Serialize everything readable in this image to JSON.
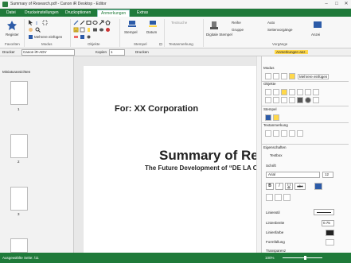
{
  "window": {
    "title": "Summary of Research.pdf - Canon iR Desktop - Editor",
    "minimize": "–",
    "maximize": "□",
    "close": "✕"
  },
  "menu": {
    "tabs": [
      "Datei",
      "Druckeinstellungen",
      "Druckoptionen",
      "Anmerkungen",
      "Extras"
    ],
    "active": "Anmerkungen"
  },
  "ribbon": {
    "groups": {
      "favoriten": "Favoriten",
      "modus": "Modus",
      "objekte": "Objekte",
      "stempel": "Stempel",
      "textanmerkung": "Textanmerkung",
      "vorgaenge": "Vorgänge"
    },
    "buttons": {
      "register": "Register",
      "mehrere_einfuegen": "Mehrere einfügen",
      "stempel": "Stempel",
      "datum": "Datum",
      "textsuche": "Textsuche",
      "digitale_stempel": "Digitale Stempel",
      "reihe": "Reihe",
      "auto": "Auto",
      "gruppe": "Gruppe",
      "seitenvorgaenge": "Seitenvorgänge",
      "anzeige": "Anzei"
    }
  },
  "printbar": {
    "drucker_label": "Drucker",
    "drucker_value": "Canon iR-ADV",
    "kopien_label": "Kopien",
    "kopien_value": "1",
    "drucken": "Drucken",
    "anmerkungen_anz": "Anmerkungen anz."
  },
  "left_panel": {
    "title": "Miniaturansichten",
    "pages": [
      "1",
      "2",
      "3"
    ]
  },
  "document": {
    "for_line": "For: XX Corporation",
    "heading": "Summary of Rese",
    "subheading": "The Future Development of “DE LA C"
  },
  "right_panel": {
    "sections": {
      "modus": "Modus",
      "objekte": "Objekte",
      "stempel": "Stempel",
      "textanmerkung": "Textanmerkung",
      "eigenschaften": "Eigenschaften"
    },
    "mehrere_einfuegen": "Mehrere einfügen",
    "textbox": "Textbox",
    "schrift": "Schrift",
    "font_name": "Arial",
    "font_size": "12",
    "bold": "B",
    "italic": "I",
    "underline": "U",
    "strike": "abc",
    "linienstil": "Linienstil",
    "linienbreite": "Linienbreite",
    "linienbreite_value": "0.75",
    "linienfarbe": "Linienfarbe",
    "formfuellung": "Formfüllung",
    "transparenz": "Transparenz"
  },
  "status": {
    "left": "Ausgewählte Seite: /11",
    "zoom": "100%"
  },
  "colors": {
    "brand": "#1f7a3a",
    "accent_blue": "#2c5ba8",
    "highlight": "#ffd84a"
  }
}
